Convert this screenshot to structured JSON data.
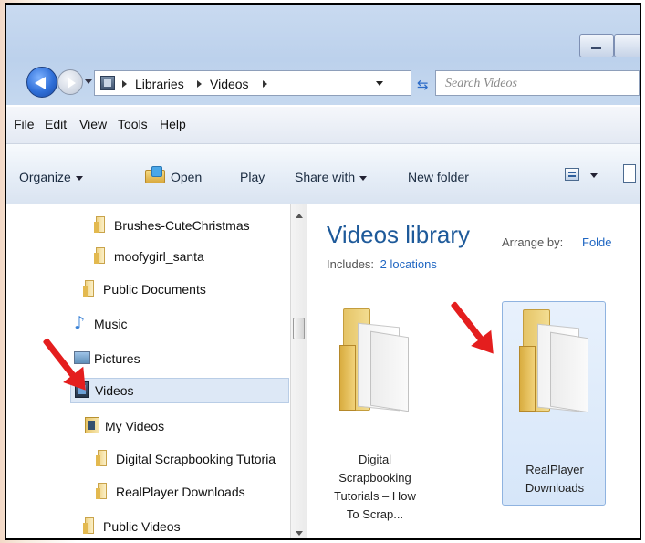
{
  "address": {
    "crumbs": [
      "Libraries",
      "Videos"
    ]
  },
  "search": {
    "placeholder": "Search Videos"
  },
  "menu": {
    "items": [
      "File",
      "Edit",
      "View",
      "Tools",
      "Help"
    ]
  },
  "commands": {
    "organize": "Organize",
    "open": "Open",
    "play": "Play",
    "share_with": "Share with",
    "new_folder": "New folder"
  },
  "nav": {
    "items": [
      {
        "label": "Brushes-CuteChristmas",
        "icon": "folder-icon"
      },
      {
        "label": "moofygirl_santa",
        "icon": "folder-icon"
      },
      {
        "label": "Public Documents",
        "icon": "folder-icon"
      },
      {
        "label": "Music",
        "icon": "music-icon"
      },
      {
        "label": "Pictures",
        "icon": "pictures-icon"
      },
      {
        "label": "Videos",
        "icon": "videos-library-icon",
        "selected": true
      },
      {
        "label": "My Videos",
        "icon": "my-videos-folder-icon"
      },
      {
        "label": "Digital Scrapbooking Tutoria",
        "icon": "folder-icon"
      },
      {
        "label": "RealPlayer Downloads",
        "icon": "folder-icon"
      },
      {
        "label": "Public Videos",
        "icon": "folder-icon"
      }
    ]
  },
  "library": {
    "title": "Videos library",
    "includes_label": "Includes:",
    "locations_link": "2 locations",
    "arrange_label": "Arrange by:",
    "arrange_value": "Folde"
  },
  "files": [
    {
      "name_lines": [
        "Digital",
        "Scrapbooking",
        "Tutorials – How",
        "To Scrap..."
      ],
      "selected": false
    },
    {
      "name_lines": [
        "RealPlayer",
        "Downloads"
      ],
      "selected": true
    }
  ],
  "annotation": {
    "arrow_color": "#e41e1e"
  }
}
